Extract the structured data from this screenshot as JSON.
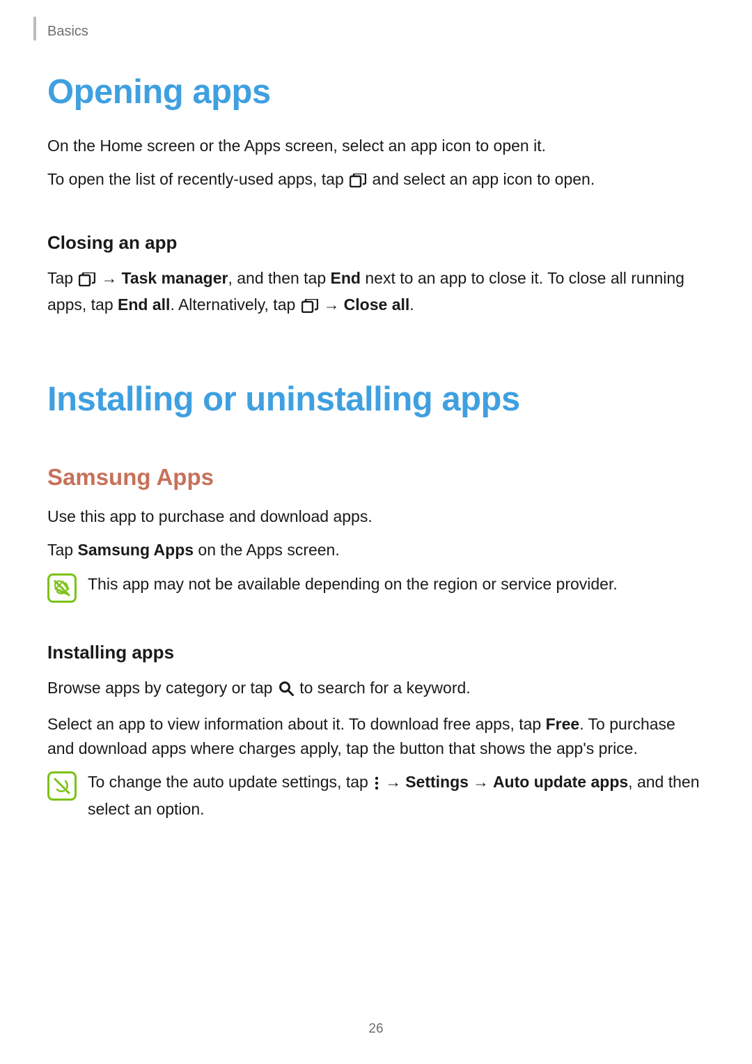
{
  "header": {
    "section": "Basics"
  },
  "h1_opening": "Opening apps",
  "opening_p1_a": "On the Home screen or the Apps screen, select an app icon to open it.",
  "opening_p2_a": "To open the list of recently-used apps, tap ",
  "opening_p2_b": " and select an app icon to open.",
  "closing_h3": "Closing an app",
  "closing_p_a": "Tap ",
  "closing_p_b": "Task manager",
  "closing_p_c": ", and then tap ",
  "closing_p_d": "End",
  "closing_p_e": " next to an app to close it. To close all running apps, tap ",
  "closing_p_f": "End all",
  "closing_p_g": ". Alternatively, tap ",
  "closing_p_h": "Close all",
  "closing_p_i": ".",
  "arrow": "→",
  "h1_install": "Installing or uninstalling apps",
  "samsung_h2": "Samsung Apps",
  "samsung_p1": "Use this app to purchase and download apps.",
  "samsung_p2_a": "Tap ",
  "samsung_p2_b": "Samsung Apps",
  "samsung_p2_c": " on the Apps screen.",
  "note1": "This app may not be available depending on the region or service provider.",
  "install_h3": "Installing apps",
  "install_p1_a": "Browse apps by category or tap ",
  "install_p1_b": " to search for a keyword.",
  "install_p2_a": "Select an app to view information about it. To download free apps, tap ",
  "install_p2_b": "Free",
  "install_p2_c": ". To purchase and download apps where charges apply, tap the button that shows the app's price.",
  "note2_a": "To change the auto update settings, tap ",
  "note2_b": "Settings",
  "note2_c": "Auto update apps",
  "note2_d": ", and then select an option.",
  "page_number": "26"
}
